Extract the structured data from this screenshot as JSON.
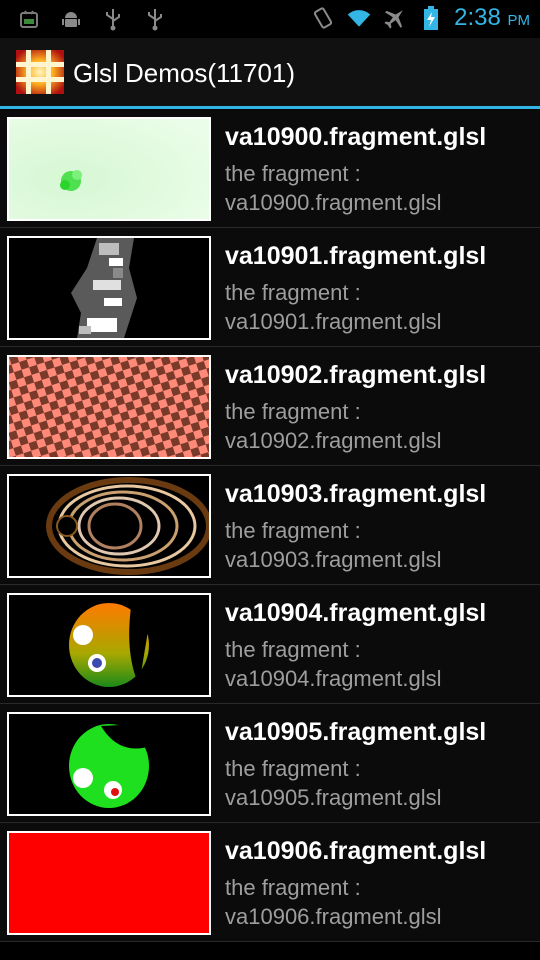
{
  "status": {
    "time": "2:38",
    "ampm": "PM",
    "accent": "#33b5e5",
    "left_icons": [
      "android-terminal-icon",
      "android-debug-icon",
      "usb-icon",
      "usb-icon"
    ],
    "right_icons": [
      "vibrate-icon",
      "wifi-icon",
      "airplane-icon",
      "battery-charging-icon"
    ]
  },
  "app": {
    "title": "Glsl Demos(11701)"
  },
  "items": [
    {
      "title": "va10900.fragment.glsl",
      "line1": "the fragment :",
      "line2": "va10900.fragment.glsl",
      "thumb": "pale-green-field"
    },
    {
      "title": "va10901.fragment.glsl",
      "line1": "the fragment :",
      "line2": "va10901.fragment.glsl",
      "thumb": "gray-noise-column"
    },
    {
      "title": "va10902.fragment.glsl",
      "line1": "the fragment :",
      "line2": "va10902.fragment.glsl",
      "thumb": "pink-brown-checkerboard"
    },
    {
      "title": "va10903.fragment.glsl",
      "line1": "the fragment :",
      "line2": "va10903.fragment.glsl",
      "thumb": "fractal-rings"
    },
    {
      "title": "va10904.fragment.glsl",
      "line1": "the fragment :",
      "line2": "va10904.fragment.glsl",
      "thumb": "orange-green-face"
    },
    {
      "title": "va10905.fragment.glsl",
      "line1": "the fragment :",
      "line2": "va10905.fragment.glsl",
      "thumb": "green-face"
    },
    {
      "title": "va10906.fragment.glsl",
      "line1": "the fragment :",
      "line2": "va10906.fragment.glsl",
      "thumb": "solid-red"
    }
  ]
}
